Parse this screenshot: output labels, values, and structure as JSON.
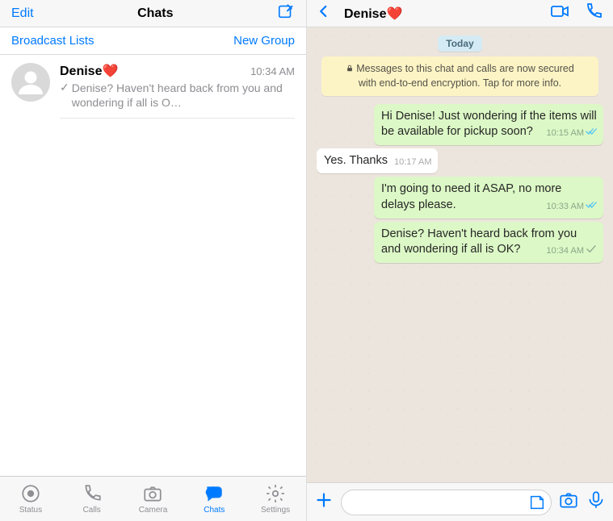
{
  "accent": "#007aff",
  "left": {
    "edit": "Edit",
    "title": "Chats",
    "broadcast": "Broadcast Lists",
    "newgroup": "New Group",
    "chat": {
      "name": "Denise❤️",
      "time": "10:34 AM",
      "tick": "✓",
      "preview": "Denise? Haven't heard back from you and wondering if all is O…"
    },
    "tabs": {
      "status": "Status",
      "calls": "Calls",
      "camera": "Camera",
      "chats": "Chats",
      "settings": "Settings"
    }
  },
  "right": {
    "title": "Denise❤️",
    "date_badge": "Today",
    "system_msg": "Messages to this chat and calls are now secured with end-to-end encryption. Tap for more info.",
    "messages": [
      {
        "dir": "out",
        "text": "Hi Denise! Just wondering if the items will be available for pickup soon?",
        "time": "10:15 AM",
        "status": "read"
      },
      {
        "dir": "in",
        "text": "Yes. Thanks",
        "time": "10:17 AM"
      },
      {
        "dir": "out",
        "text": "I'm going to need it ASAP, no more delays please.",
        "time": "10:33 AM",
        "status": "read"
      },
      {
        "dir": "out",
        "text": "Denise? Haven't heard back from you and wondering if all is OK?",
        "time": "10:34 AM",
        "status": "sent"
      }
    ],
    "input_placeholder": ""
  }
}
